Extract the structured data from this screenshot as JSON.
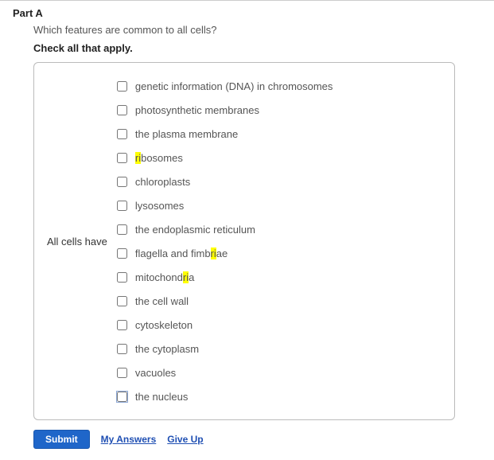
{
  "part": {
    "label": "Part A"
  },
  "question": {
    "text": "Which features are common to all cells?"
  },
  "instruction": {
    "text": "Check all that apply."
  },
  "row_label": "All cells have",
  "options": [
    {
      "label": "genetic information (DNA) in chromosomes"
    },
    {
      "label": "photosynthetic membranes"
    },
    {
      "label": "the plasma membrane"
    },
    {
      "pre": "",
      "hl": "ri",
      "post": "bosomes"
    },
    {
      "label": "chloroplasts"
    },
    {
      "label": "lysosomes"
    },
    {
      "label": "the endoplasmic reticulum"
    },
    {
      "pre": "flagella and fimb",
      "hl": "ri",
      "post": "ae"
    },
    {
      "pre": "mitochond",
      "hl": "ri",
      "post": "a"
    },
    {
      "label": "the cell wall"
    },
    {
      "label": "cytoskeleton"
    },
    {
      "label": "the cytoplasm"
    },
    {
      "label": "vacuoles"
    },
    {
      "label": "the nucleus"
    }
  ],
  "buttons": {
    "submit": "Submit",
    "my_answers": "My Answers",
    "give_up": "Give Up"
  }
}
